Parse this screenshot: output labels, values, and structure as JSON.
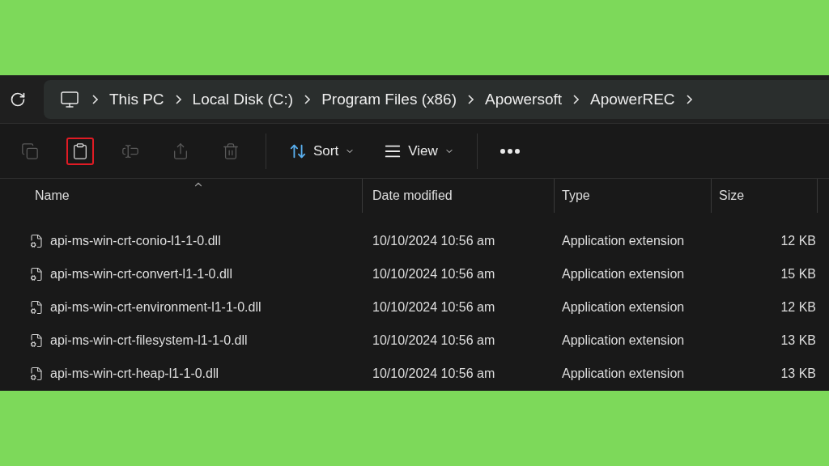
{
  "address_bar": {
    "breadcrumbs": [
      "This PC",
      "Local Disk (C:)",
      "Program Files (x86)",
      "Apowersoft",
      "ApowerREC"
    ]
  },
  "toolbar": [
    {
      "kind": "copy",
      "disabled": true,
      "highlighted": false
    },
    {
      "kind": "paste",
      "disabled": false,
      "highlighted": true
    },
    {
      "kind": "rename",
      "disabled": true,
      "highlighted": false
    },
    {
      "kind": "share",
      "disabled": true,
      "highlighted": false
    },
    {
      "kind": "delete",
      "disabled": true,
      "highlighted": false
    },
    {
      "kind": "sort",
      "label": "Sort"
    },
    {
      "kind": "view",
      "label": "View"
    },
    {
      "kind": "more"
    }
  ],
  "table": {
    "columns": [
      "Name",
      "Date modified",
      "Type",
      "Size"
    ],
    "rows": [
      {
        "name": "api-ms-win-crt-conio-l1-1-0.dll",
        "date": "10/10/2024 10:56 am",
        "type": "Application extension",
        "size": "12 KB"
      },
      {
        "name": "api-ms-win-crt-convert-l1-1-0.dll",
        "date": "10/10/2024 10:56 am",
        "type": "Application extension",
        "size": "15 KB"
      },
      {
        "name": "api-ms-win-crt-environment-l1-1-0.dll",
        "date": "10/10/2024 10:56 am",
        "type": "Application extension",
        "size": "12 KB"
      },
      {
        "name": "api-ms-win-crt-filesystem-l1-1-0.dll",
        "date": "10/10/2024 10:56 am",
        "type": "Application extension",
        "size": "13 KB"
      },
      {
        "name": "api-ms-win-crt-heap-l1-1-0.dll",
        "date": "10/10/2024 10:56 am",
        "type": "Application extension",
        "size": "13 KB"
      }
    ]
  }
}
